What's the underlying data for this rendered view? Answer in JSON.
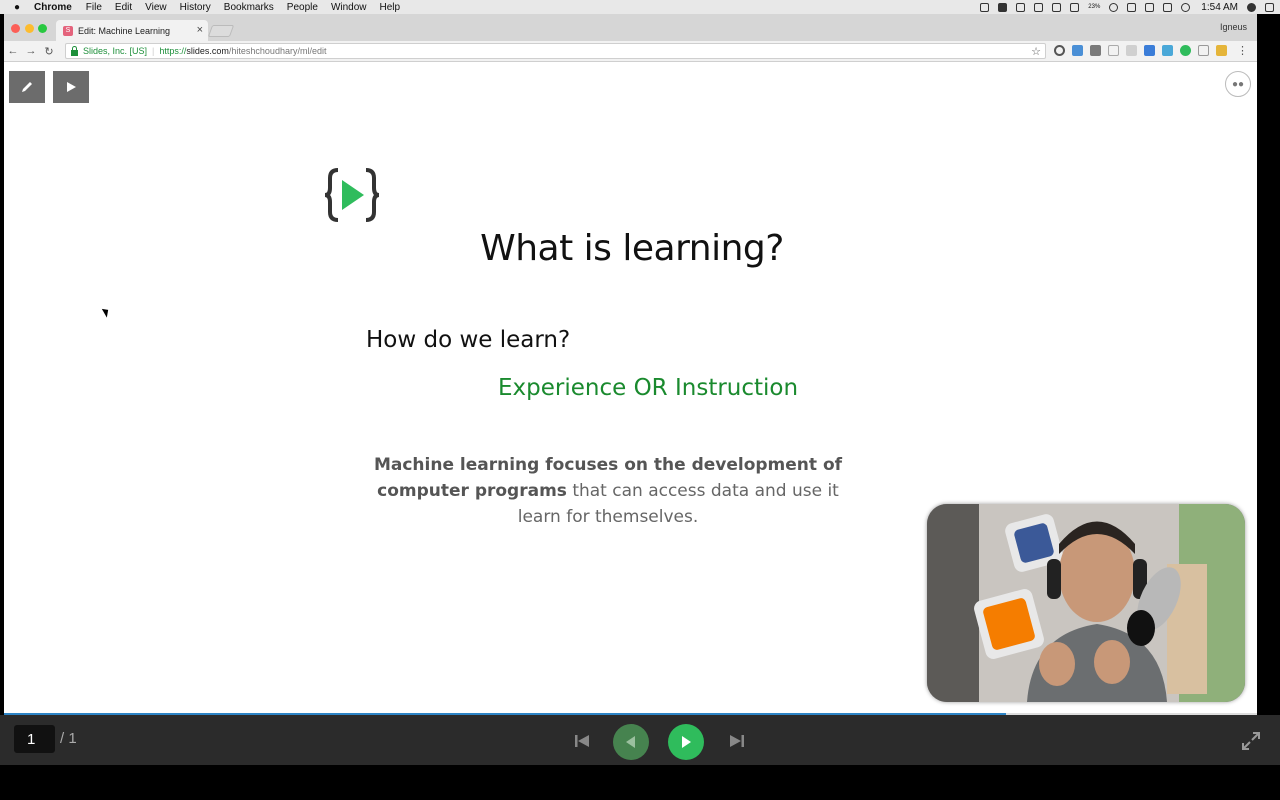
{
  "menubar": {
    "app": "Chrome",
    "items": [
      "File",
      "Edit",
      "View",
      "History",
      "Bookmarks",
      "People",
      "Window",
      "Help"
    ],
    "battery": "23%",
    "clock": "1:54 AM"
  },
  "browser": {
    "tab_title": "Edit: Machine Learning",
    "tab_favicon": "S",
    "profile": "Igneus",
    "secure_label": "Slides, Inc. [US]",
    "url_scheme": "https://",
    "url_host": "slides.com",
    "url_path": "/hiteshchoudhary/ml/edit"
  },
  "slide": {
    "title": "What is learning?",
    "question": "How do we learn?",
    "answer": "Experience OR Instruction",
    "body_bold": "Machine learning focuses on the development of computer programs",
    "body_rest": " that can access data and use it learn for themselves.",
    "accent_color": "#1a8a2e",
    "logo_color": "#2fbc5c"
  },
  "controls": {
    "current_page": "1",
    "total_pages": "/ 1",
    "progress_percent": 80
  },
  "icons": {
    "edit": "pencil-icon",
    "present": "play-icon",
    "collaborators": "people-icon",
    "first": "skip-first-icon",
    "prev": "previous-icon",
    "next": "next-icon",
    "last": "skip-last-icon",
    "fullscreen": "fullscreen-icon"
  }
}
